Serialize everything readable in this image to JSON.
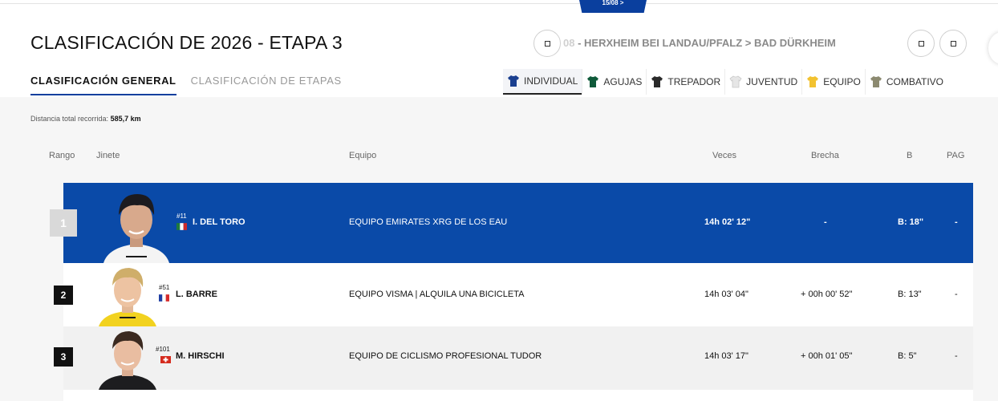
{
  "header": {
    "date_tab": "15/08 >",
    "title": "CLASIFICACIÓN DE 2026 - ETAPA 3",
    "stage_route_prefix": "08",
    "stage_route": " - HERXHEIM BEI LANDAU/PFALZ > BAD DÜRKHEIM"
  },
  "main_tabs": [
    {
      "label": "CLASIFICACIÓN GENERAL",
      "active": true
    },
    {
      "label": "CLASIFICACIÓN DE ETAPAS",
      "active": false
    }
  ],
  "filter_tabs": [
    {
      "label": "INDIVIDUAL",
      "icon": "jersey-blue-icon",
      "color": "#1a3f8f",
      "active": true
    },
    {
      "label": "AGUJAS",
      "icon": "jersey-green-icon",
      "color": "#0f5a3a",
      "active": false
    },
    {
      "label": "TREPADOR",
      "icon": "jersey-black-icon",
      "color": "#2a2a2a",
      "active": false
    },
    {
      "label": "JUVENTUD",
      "icon": "jersey-white-icon",
      "color": "#e6e6e6",
      "active": false
    },
    {
      "label": "EQUIPO",
      "icon": "jersey-yellow-icon",
      "color": "#f2c230",
      "active": false
    },
    {
      "label": "COMBATIVO",
      "icon": "jersey-camo-icon",
      "color": "#8c8a70",
      "active": false
    }
  ],
  "distance": {
    "label": "Distancia total recorrida:",
    "value": "585,7 km"
  },
  "columns": {
    "rank": "Rango",
    "rider": "Jinete",
    "team": "Equipo",
    "time": "Veces",
    "gap": "Brecha",
    "bonus": "B",
    "pag": "PAG"
  },
  "rows": [
    {
      "rank": "1",
      "bib": "#11",
      "flag": "mx",
      "rider": "I. DEL TORO",
      "team": "EQUIPO EMIRATES XRG DE LOS EAU",
      "time": "14h 02' 12\"",
      "gap": "-",
      "bonus": "B: 18\"",
      "pag": "-"
    },
    {
      "rank": "2",
      "bib": "#51",
      "flag": "fr",
      "rider": "L. BARRE",
      "team": "EQUIPO VISMA | ALQUILA UNA BICICLETA",
      "time": "14h 03' 04\"",
      "gap": "+ 00h 00' 52\"",
      "bonus": "B: 13\"",
      "pag": "-"
    },
    {
      "rank": "3",
      "bib": "#101",
      "flag": "ch",
      "rider": "M. HIRSCHI",
      "team": "EQUIPO DE CICLISMO PROFESIONAL TUDOR",
      "time": "14h 03' 17\"",
      "gap": "+ 00h 01' 05\"",
      "bonus": "B: 5\"",
      "pag": "-"
    }
  ],
  "colors": {
    "accent": "#0a4aa8",
    "dark": "#111111"
  }
}
